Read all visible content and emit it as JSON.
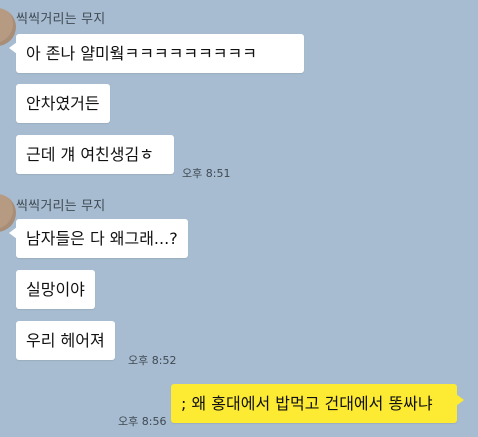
{
  "colors": {
    "background": "#a7bcd0",
    "incoming_bubble": "#ffffff",
    "outgoing_bubble": "#fdea33"
  },
  "group1": {
    "sender": "씩씩거리는 무지",
    "messages": [
      "아 존나 얄미웤ㅋㅋㅋㅋㅋㅋㅋㅋㅋ",
      "안차였거든",
      "근데 걔 여친생김ㅎ"
    ],
    "time": "오후 8:51"
  },
  "group2": {
    "sender": "씩씩거리는 무지",
    "messages": [
      "남자들은 다 왜그래...?",
      "실망이야",
      "우리 헤어져"
    ],
    "time": "오후 8:52"
  },
  "outgoing": {
    "message": "; 왜 홍대에서 밥먹고 건대에서 똥싸냐",
    "time": "오후 8:56"
  }
}
